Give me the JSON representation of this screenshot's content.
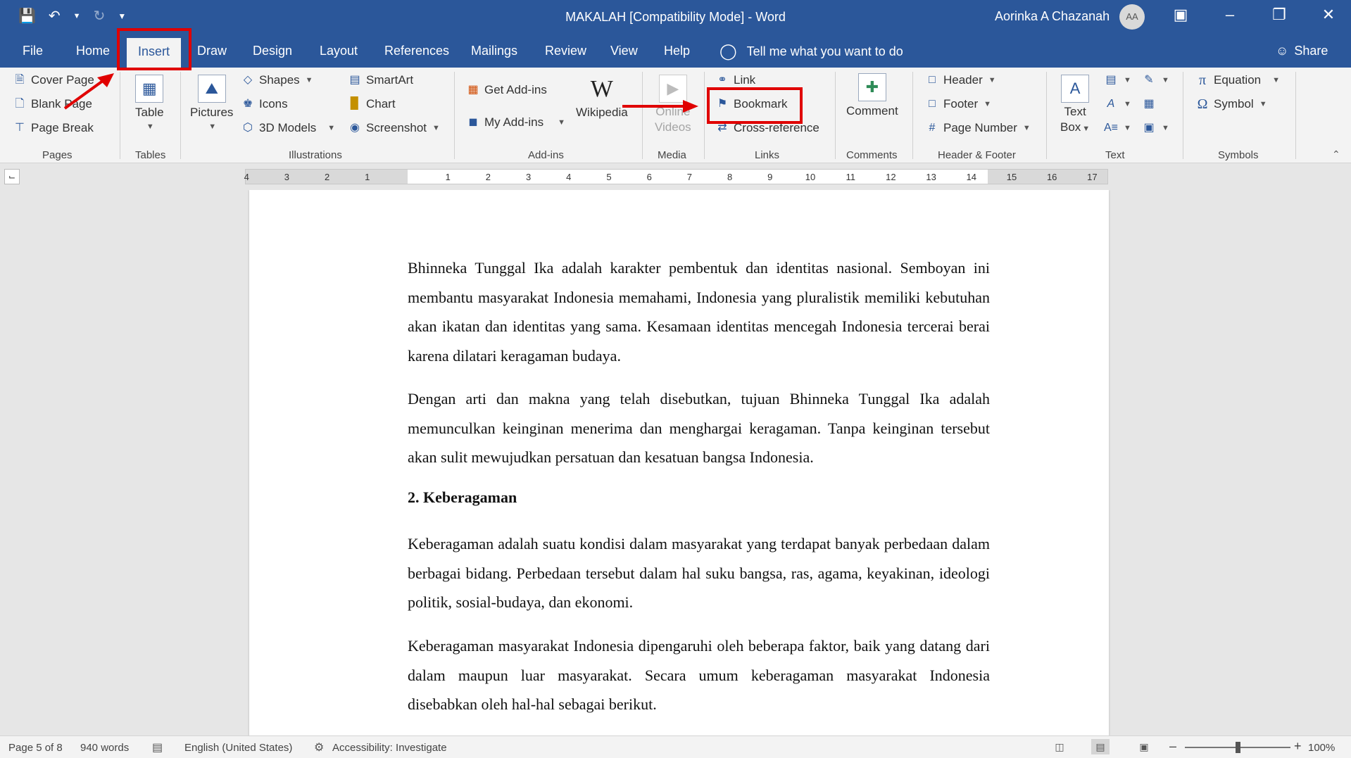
{
  "window": {
    "title": "MAKALAH [Compatibility Mode]  -  Word",
    "user_name": "Aorinka A Chazanah",
    "avatar_initials": "AA"
  },
  "icons": {
    "save": "floppy-disk-icon",
    "undo": "undo-icon",
    "redo": "redo-icon",
    "ribbon_display": "ribbon-display-icon",
    "minimize": "minimize-icon",
    "restore": "restore-icon",
    "close": "close-icon"
  },
  "tabs": [
    "File",
    "Home",
    "Insert",
    "Draw",
    "Design",
    "Layout",
    "References",
    "Mailings",
    "Review",
    "View",
    "Help"
  ],
  "active_tab": "Insert",
  "tell_me": "Tell me what you want to do",
  "share": "Share",
  "ribbon": {
    "pages": {
      "cover_page": "Cover Page",
      "blank_page": "Blank Page",
      "page_break": "Page Break",
      "label": "Pages"
    },
    "tables": {
      "table": "Table",
      "label": "Tables"
    },
    "illustrations": {
      "pictures": "Pictures",
      "shapes": "Shapes",
      "icons": "Icons",
      "models_3d": "3D Models",
      "smartart": "SmartArt",
      "chart": "Chart",
      "screenshot": "Screenshot",
      "label": "Illustrations"
    },
    "addins": {
      "get_addins": "Get Add-ins",
      "my_addins": "My Add-ins",
      "wikipedia": "Wikipedia",
      "label": "Add-ins"
    },
    "media": {
      "online_videos_1": "Online",
      "online_videos_2": "Videos",
      "label": "Media"
    },
    "links": {
      "link": "Link",
      "bookmark": "Bookmark",
      "cross_reference": "Cross-reference",
      "label": "Links"
    },
    "comments": {
      "comment": "Comment",
      "label": "Comments"
    },
    "header_footer": {
      "header": "Header",
      "footer": "Footer",
      "page_number": "Page Number",
      "label": "Header & Footer"
    },
    "text": {
      "text_box_1": "Text",
      "text_box_2": "Box",
      "label": "Text"
    },
    "symbols": {
      "equation": "Equation",
      "symbol": "Symbol",
      "label": "Symbols"
    }
  },
  "ruler_ticks": [
    "4",
    "3",
    "2",
    "1",
    "1",
    "2",
    "3",
    "4",
    "5",
    "6",
    "7",
    "8",
    "9",
    "10",
    "11",
    "12",
    "13",
    "14",
    "15",
    "16",
    "17"
  ],
  "document": {
    "paragraph_1": "Bhinneka Tunggal Ika adalah karakter pembentuk dan identitas nasional. Semboyan ini membantu masyarakat Indonesia memahami, Indonesia yang pluralistik memiliki kebutuhan akan ikatan dan identitas yang sama. Kesamaan identitas mencegah Indonesia tercerai berai karena dilatari keragaman budaya.",
    "paragraph_2": "Dengan arti dan makna yang telah disebutkan, tujuan Bhinneka Tunggal Ika adalah memunculkan keinginan menerima dan menghargai keragaman. Tanpa keinginan tersebut akan sulit mewujudkan persatuan dan kesatuan bangsa Indonesia.",
    "heading": "2. Keberagaman",
    "paragraph_3": "Keberagaman adalah suatu kondisi dalam masyarakat yang terdapat banyak perbedaan dalam berbagai bidang. Perbedaan tersebut dalam hal suku bangsa, ras, agama, keyakinan, ideologi politik, sosial-budaya, dan ekonomi.",
    "paragraph_4": "Keberagaman masyarakat Indonesia dipengaruhi oleh beberapa faktor, baik yang datang dari dalam maupun luar masyarakat. Secara umum keberagaman masyarakat Indonesia disebabkan oleh hal-hal sebagai berikut."
  },
  "status": {
    "page": "Page 5 of 8",
    "words": "940 words",
    "language": "English (United States)",
    "accessibility": "Accessibility: Investigate",
    "zoom": "100%",
    "zoom_fraction": 0.5
  },
  "colors": {
    "accent": "#2b579a",
    "highlight": "#e00000"
  }
}
